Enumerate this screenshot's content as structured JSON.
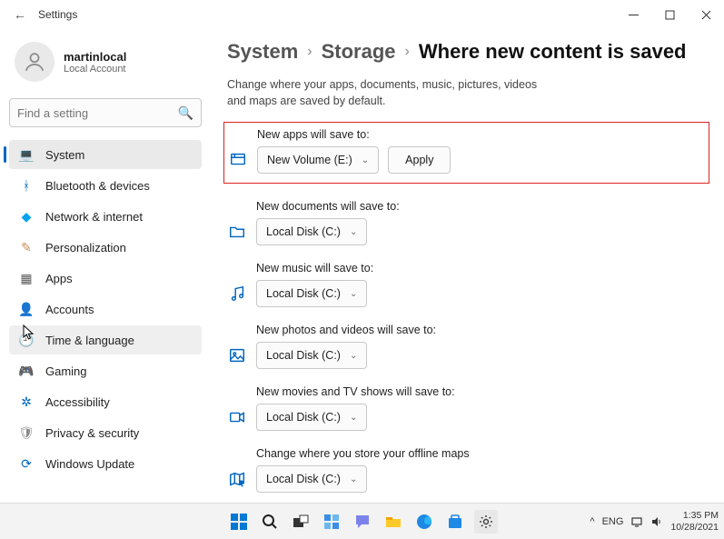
{
  "window": {
    "app_title": "Settings",
    "back_icon": "←"
  },
  "user": {
    "name": "martinlocal",
    "account_type": "Local Account"
  },
  "search": {
    "placeholder": "Find a setting"
  },
  "nav": {
    "items": [
      {
        "icon": "💻",
        "label": "System",
        "color": "#0078d4",
        "active": true
      },
      {
        "icon": "ᚼ",
        "label": "Bluetooth & devices",
        "color": "#0067c0"
      },
      {
        "icon": "◆",
        "label": "Network & internet",
        "color": "#00a2ed"
      },
      {
        "icon": "✎",
        "label": "Personalization",
        "color": "#c98f52"
      },
      {
        "icon": "▦",
        "label": "Apps",
        "color": "#5b5b5b"
      },
      {
        "icon": "👤",
        "label": "Accounts",
        "color": "#d08a6a"
      },
      {
        "icon": "🕘",
        "label": "Time & language",
        "color": "#5b8bd0",
        "hover": true
      },
      {
        "icon": "🎮",
        "label": "Gaming",
        "color": "#6e6e6e"
      },
      {
        "icon": "✲",
        "label": "Accessibility",
        "color": "#0067c0"
      },
      {
        "icon": "🛡",
        "label": "Privacy & security",
        "color": "#8a8a8a"
      },
      {
        "icon": "⟳",
        "label": "Windows Update",
        "color": "#0067c0"
      }
    ]
  },
  "breadcrumb": {
    "a": "System",
    "b": "Storage",
    "c": "Where new content is saved",
    "sep": "›"
  },
  "description": "Change where your apps, documents, music, pictures, videos and maps are saved by default.",
  "settings": [
    {
      "label": "New apps will save to:",
      "value": "New Volume (E:)",
      "apply": "Apply",
      "highlight": true,
      "icon": "apps"
    },
    {
      "label": "New documents will save to:",
      "value": "Local Disk (C:)",
      "icon": "folder"
    },
    {
      "label": "New music will save to:",
      "value": "Local Disk (C:)",
      "icon": "music"
    },
    {
      "label": "New photos and videos will save to:",
      "value": "Local Disk (C:)",
      "icon": "image"
    },
    {
      "label": "New movies and TV shows will save to:",
      "value": "Local Disk (C:)",
      "icon": "video"
    },
    {
      "label": "Change where you store your offline maps",
      "value": "Local Disk (C:)",
      "icon": "map"
    }
  ],
  "taskbar": {
    "lang": "ENG",
    "time": "1:35 PM",
    "date": "10/28/2021",
    "chevron": "^"
  }
}
